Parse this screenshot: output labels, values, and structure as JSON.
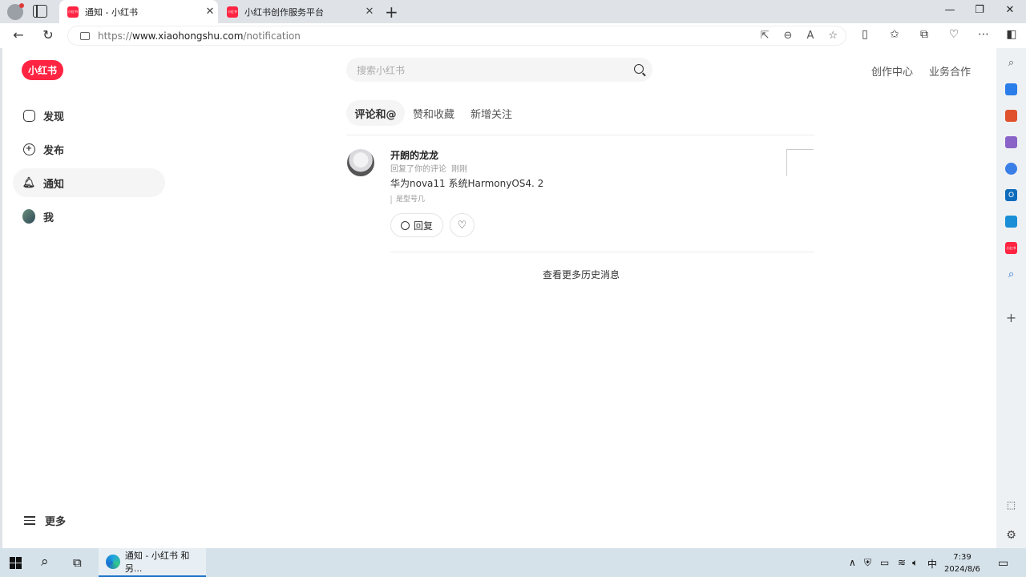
{
  "browser": {
    "tabs": [
      {
        "title": "通知 - 小红书",
        "favicon": "xiaohongshu-icon"
      },
      {
        "title": "小红书创作服务平台",
        "favicon": "xiaohongshu-icon"
      }
    ],
    "url_prefix": "https://",
    "url_host": "www.xiaohongshu.com",
    "url_path": "/notification"
  },
  "site": {
    "logo_text": "小红书",
    "brand_color": "#ff2442",
    "search_placeholder": "搜索小红书",
    "top_links": [
      "创作中心",
      "业务合作"
    ],
    "nav": [
      {
        "label": "发现",
        "icon": "home-icon"
      },
      {
        "label": "发布",
        "icon": "plus-circle-icon"
      },
      {
        "label": "通知",
        "icon": "bell-icon",
        "active": true
      },
      {
        "label": "我",
        "icon": "avatar"
      }
    ],
    "more_label": "更多"
  },
  "notifications": {
    "tabs": [
      "评论和@",
      "赞和收藏",
      "新增关注"
    ],
    "active_tab": "评论和@",
    "items": [
      {
        "user": "开朗的龙龙",
        "action": "回复了你的评论",
        "time": "刚刚",
        "content": "华为nova11 系统HarmonyOS4. 2",
        "quote": "是型号几",
        "reply_label": "回复"
      }
    ],
    "more_history": "查看更多历史消息"
  },
  "taskbar": {
    "app_title": "通知 - 小红书 和另...",
    "ime": "中",
    "time": "7:39",
    "date": "2024/8/6"
  }
}
